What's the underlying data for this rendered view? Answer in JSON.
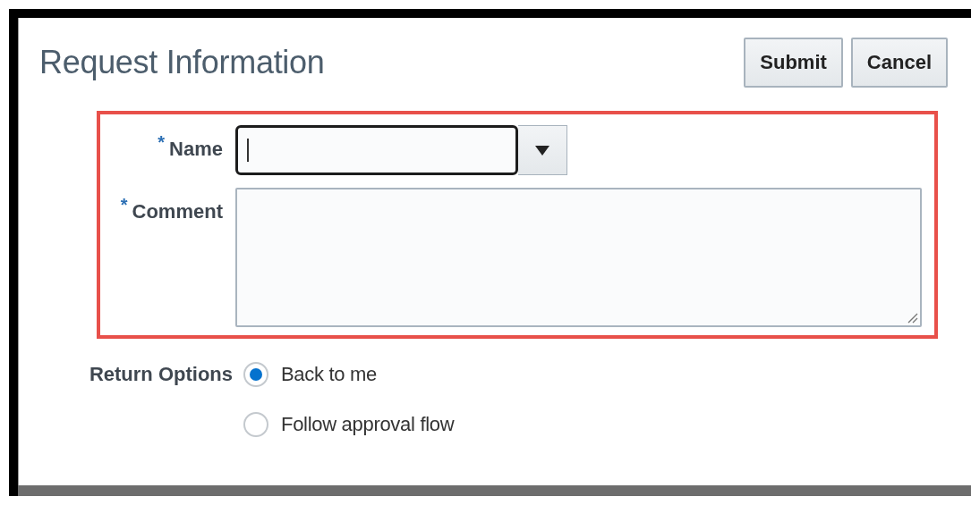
{
  "dialog": {
    "title": "Request Information",
    "buttons": [
      {
        "label": "Submit"
      },
      {
        "label": "Cancel"
      }
    ],
    "form": {
      "highlighted": true,
      "fields": [
        {
          "kind": "combobox",
          "required_mark": "*",
          "label": "Name",
          "focused": true
        },
        {
          "kind": "textarea",
          "required_mark": "*",
          "label": "Comment",
          "focused": false
        }
      ]
    },
    "return_options": {
      "label": "Return Options",
      "options": [
        {
          "label": "Back to me",
          "selected": true
        },
        {
          "label": "Follow approval flow",
          "selected": false
        }
      ]
    }
  }
}
